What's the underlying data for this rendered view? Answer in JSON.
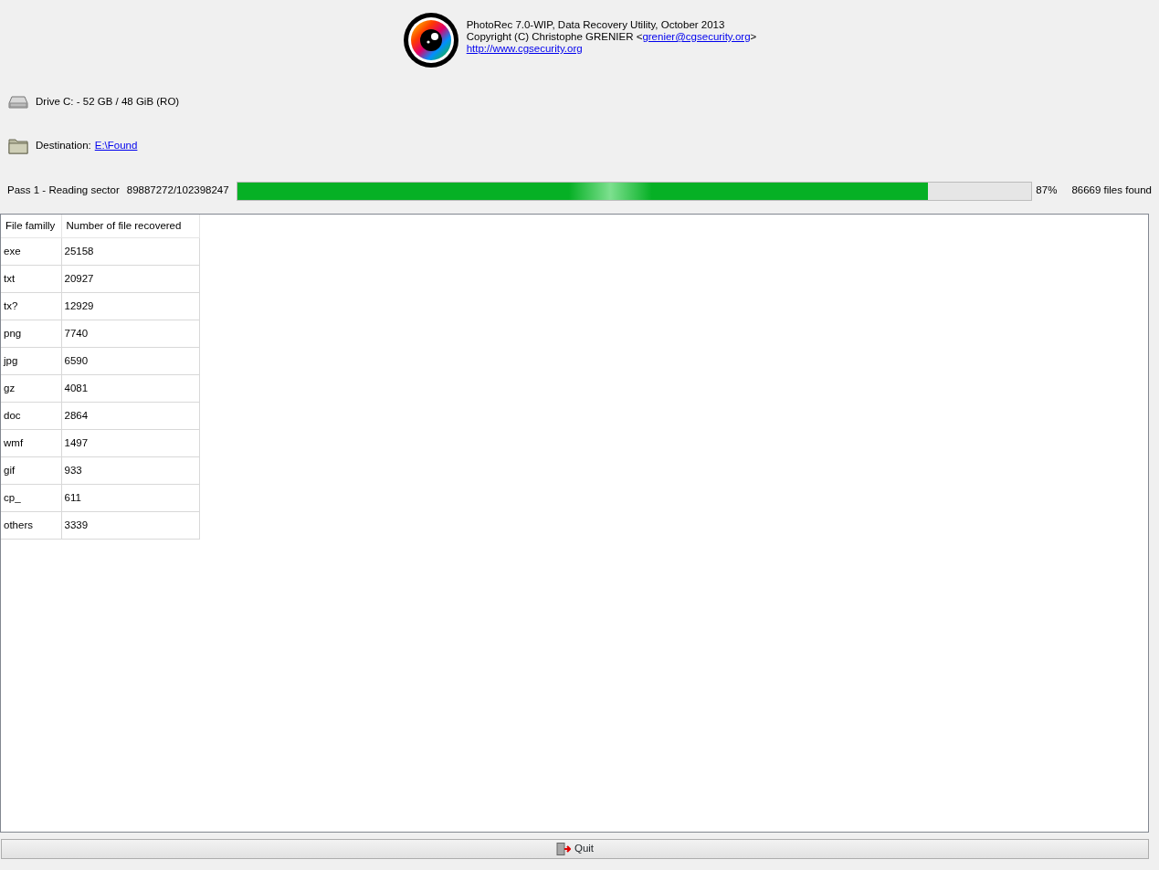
{
  "header": {
    "title": "PhotoRec 7.0-WIP, Data Recovery Utility, October 2013",
    "copyright": "Copyright (C) Christophe GRENIER <",
    "email": "grenier@cgsecurity.org",
    "copyright_end": ">",
    "website": "http://www.cgsecurity.org"
  },
  "drive": {
    "label": "Drive C: - 52 GB / 48 GiB (RO)"
  },
  "destination": {
    "label": "Destination:",
    "path": "E:\\Found"
  },
  "progress": {
    "pass": "Pass 1 - Reading sector",
    "sector": "89887272/102398247",
    "level": 0.87,
    "percent": "87%",
    "files_found": "86669 files found"
  },
  "table": {
    "columns": [
      "File familly",
      "Number of file recovered"
    ],
    "rows": [
      [
        "exe",
        "25158"
      ],
      [
        "txt",
        "20927"
      ],
      [
        "tx?",
        "12929"
      ],
      [
        "png",
        "7740"
      ],
      [
        "jpg",
        "6590"
      ],
      [
        "gz",
        "4081"
      ],
      [
        "doc",
        "2864"
      ],
      [
        "wmf",
        "1497"
      ],
      [
        "gif",
        "933"
      ],
      [
        "cp_",
        "611"
      ],
      [
        "others",
        "3339"
      ]
    ]
  },
  "quit_button": {
    "label": "Quit"
  }
}
